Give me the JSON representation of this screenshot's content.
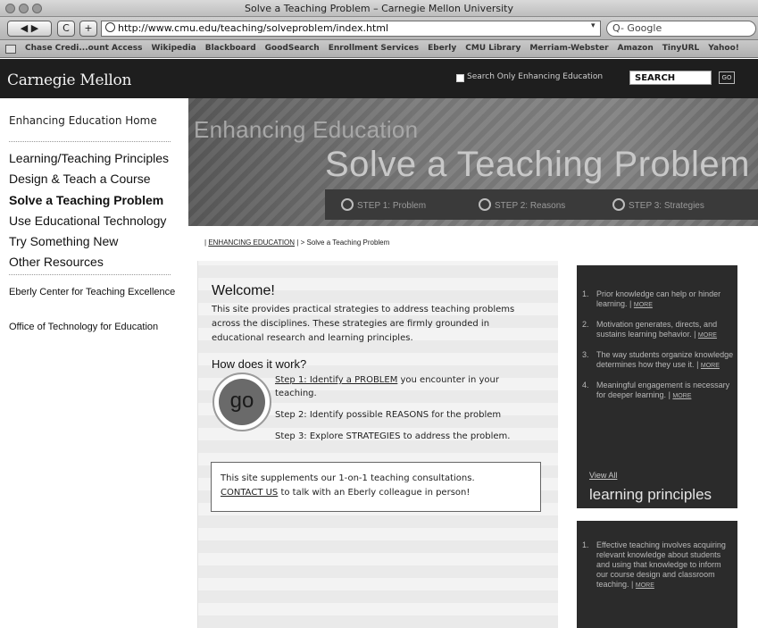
{
  "window": {
    "title": "Solve a Teaching Problem – Carnegie Mellon University"
  },
  "toolbar": {
    "back_forward": "◀ ▶",
    "reload": "C",
    "add": "+",
    "url": "http://www.cmu.edu/teaching/solveproblem/index.html",
    "search_placeholder": "Q- Google"
  },
  "bookmarks": [
    "Chase Credi...ount Access",
    "Wikipedia",
    "Blackboard",
    "GoodSearch",
    "Enrollment Services",
    "Eberly",
    "CMU Library",
    "Merriam-Webster",
    "Amazon",
    "TinyURL",
    "Yahoo!"
  ],
  "header": {
    "logo": "Carnegie Mellon",
    "search_only_label": "Search Only Enhancing Education",
    "search_value": "SEARCH",
    "go_label": "GO"
  },
  "sidebar": {
    "home": "Enhancing Education Home",
    "items": [
      {
        "label": "Learning/Teaching Principles"
      },
      {
        "label": "Design & Teach a Course"
      },
      {
        "label": "Solve a Teaching Problem"
      },
      {
        "label": "Use Educational Technology"
      },
      {
        "label": "Try Something New"
      },
      {
        "label": "Other Resources"
      }
    ],
    "eberly": "Eberly Center for Teaching Excellence",
    "office": "Office of Technology for Education"
  },
  "banner": {
    "line1": "Enhancing Education",
    "line2": "Solve a Teaching Problem",
    "steps": [
      "STEP 1: Problem",
      "STEP 2: Reasons",
      "STEP 3: Strategies"
    ]
  },
  "breadcrumb": {
    "prefix": "|",
    "link": "ENHANCING EDUCATION",
    "rest": "| > Solve a Teaching Problem"
  },
  "main": {
    "welcome": "Welcome!",
    "intro": "This site provides practical strategies to address teaching problems across the disciplines. These strategies are firmly grounded in educational research and learning principles.",
    "how": "How does it work?",
    "go": "go",
    "step1_link": "Step 1: Identify a PROBLEM",
    "step1_rest": " you encounter in your teaching.",
    "step2": "Step 2: Identify possible REASONS for the problem",
    "step3": "Step 3: Explore STRATEGIES to address the problem.",
    "note_text": "This site supplements our 1-on-1 teaching consultations.",
    "note_link": "CONTACT US",
    "note_rest": " to talk with an Eberly colleague in person!"
  },
  "principles": {
    "items": [
      {
        "n": "1.",
        "text": "Prior knowledge can help or hinder learning.",
        "more": "MORE"
      },
      {
        "n": "2.",
        "text": "Motivation generates, directs, and sustains learning behavior.",
        "more": "MORE"
      },
      {
        "n": "3.",
        "text": "The way students organize knowledge determines how they use it.",
        "more": "MORE"
      },
      {
        "n": "4.",
        "text": "Meaningful engagement is necessary for deeper learning.",
        "more": "MORE"
      }
    ],
    "view_all": "View All",
    "title": "learning principles"
  },
  "teaching": {
    "items": [
      {
        "n": "1.",
        "text": "Effective teaching involves acquiring relevant knowledge about students and using that knowledge to inform our course design and classroom teaching.",
        "more": "MORE"
      }
    ]
  }
}
